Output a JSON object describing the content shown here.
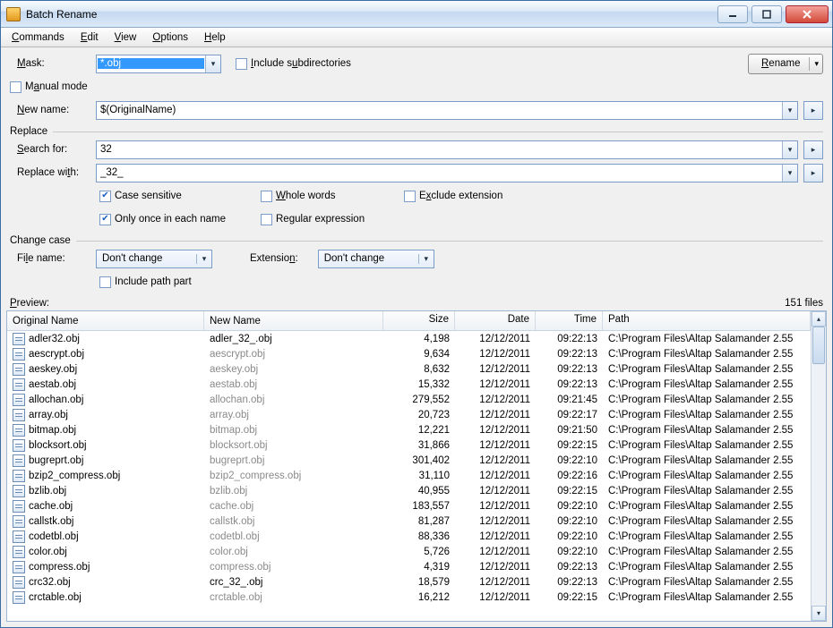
{
  "window": {
    "title": "Batch Rename"
  },
  "menu": {
    "commands": "Commands",
    "edit": "Edit",
    "view": "View",
    "options": "Options",
    "help": "Help"
  },
  "mask": {
    "label": "Mask:",
    "value": "*.obj",
    "include_sub": "Include subdirectories",
    "rename_btn": "Rename"
  },
  "manual": {
    "label": "Manual mode",
    "newname_label": "New name:",
    "newname_value": "$(OriginalName)"
  },
  "replace": {
    "title": "Replace",
    "search_label": "Search for:",
    "search_value": "32",
    "replace_label": "Replace with:",
    "replace_value": "_32_",
    "case": "Case sensitive",
    "whole": "Whole words",
    "exclude": "Exclude extension",
    "once": "Only once in each name",
    "regex": "Regular expression"
  },
  "changecase": {
    "title": "Change case",
    "filename_label": "File name:",
    "filename_value": "Don't change",
    "ext_label": "Extension:",
    "ext_value": "Don't change",
    "include_path": "Include path part"
  },
  "preview": {
    "label": "Preview:",
    "count": "151 files"
  },
  "columns": {
    "orig": "Original Name",
    "new": "New Name",
    "size": "Size",
    "date": "Date",
    "time": "Time",
    "path": "Path"
  },
  "common_path": "C:\\Program Files\\Altap Salamander 2.55",
  "rows": [
    {
      "orig": "adler32.obj",
      "new": "adler_32_.obj",
      "changed": true,
      "size": "4,198",
      "date": "12/12/2011",
      "time": "09:22:13"
    },
    {
      "orig": "aescrypt.obj",
      "new": "aescrypt.obj",
      "changed": false,
      "size": "9,634",
      "date": "12/12/2011",
      "time": "09:22:13"
    },
    {
      "orig": "aeskey.obj",
      "new": "aeskey.obj",
      "changed": false,
      "size": "8,632",
      "date": "12/12/2011",
      "time": "09:22:13"
    },
    {
      "orig": "aestab.obj",
      "new": "aestab.obj",
      "changed": false,
      "size": "15,332",
      "date": "12/12/2011",
      "time": "09:22:13"
    },
    {
      "orig": "allochan.obj",
      "new": "allochan.obj",
      "changed": false,
      "size": "279,552",
      "date": "12/12/2011",
      "time": "09:21:45"
    },
    {
      "orig": "array.obj",
      "new": "array.obj",
      "changed": false,
      "size": "20,723",
      "date": "12/12/2011",
      "time": "09:22:17"
    },
    {
      "orig": "bitmap.obj",
      "new": "bitmap.obj",
      "changed": false,
      "size": "12,221",
      "date": "12/12/2011",
      "time": "09:21:50"
    },
    {
      "orig": "blocksort.obj",
      "new": "blocksort.obj",
      "changed": false,
      "size": "31,866",
      "date": "12/12/2011",
      "time": "09:22:15"
    },
    {
      "orig": "bugreprt.obj",
      "new": "bugreprt.obj",
      "changed": false,
      "size": "301,402",
      "date": "12/12/2011",
      "time": "09:22:10"
    },
    {
      "orig": "bzip2_compress.obj",
      "new": "bzip2_compress.obj",
      "changed": false,
      "size": "31,110",
      "date": "12/12/2011",
      "time": "09:22:16"
    },
    {
      "orig": "bzlib.obj",
      "new": "bzlib.obj",
      "changed": false,
      "size": "40,955",
      "date": "12/12/2011",
      "time": "09:22:15"
    },
    {
      "orig": "cache.obj",
      "new": "cache.obj",
      "changed": false,
      "size": "183,557",
      "date": "12/12/2011",
      "time": "09:22:10"
    },
    {
      "orig": "callstk.obj",
      "new": "callstk.obj",
      "changed": false,
      "size": "81,287",
      "date": "12/12/2011",
      "time": "09:22:10"
    },
    {
      "orig": "codetbl.obj",
      "new": "codetbl.obj",
      "changed": false,
      "size": "88,336",
      "date": "12/12/2011",
      "time": "09:22:10"
    },
    {
      "orig": "color.obj",
      "new": "color.obj",
      "changed": false,
      "size": "5,726",
      "date": "12/12/2011",
      "time": "09:22:10"
    },
    {
      "orig": "compress.obj",
      "new": "compress.obj",
      "changed": false,
      "size": "4,319",
      "date": "12/12/2011",
      "time": "09:22:13"
    },
    {
      "orig": "crc32.obj",
      "new": "crc_32_.obj",
      "changed": true,
      "size": "18,579",
      "date": "12/12/2011",
      "time": "09:22:13"
    },
    {
      "orig": "crctable.obj",
      "new": "crctable.obj",
      "changed": false,
      "size": "16,212",
      "date": "12/12/2011",
      "time": "09:22:15"
    }
  ]
}
